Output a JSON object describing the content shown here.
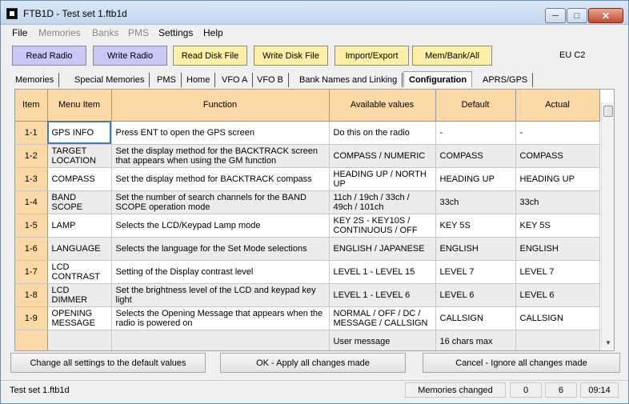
{
  "window": {
    "title": "FTB1D - Test set 1.ftb1d"
  },
  "menu": [
    {
      "label": "File",
      "disabled": false
    },
    {
      "label": "Memories",
      "disabled": true
    },
    {
      "label": "Banks",
      "disabled": true
    },
    {
      "label": "PMS",
      "disabled": true
    },
    {
      "label": "Settings",
      "disabled": false
    },
    {
      "label": "Help",
      "disabled": false
    }
  ],
  "toolbar": {
    "read_radio": "Read Radio",
    "write_radio": "Write Radio",
    "read_disk": "Read Disk File",
    "write_disk": "Write Disk File",
    "import_export": "Import/Export",
    "mem_bank_all": "Mem/Bank/All",
    "region": "EU C2"
  },
  "tabs": [
    "Memories",
    "Special Memories",
    "PMS",
    "Home",
    "VFO A",
    "VFO B",
    "Bank Names and Linking",
    "Configuration",
    "APRS/GPS"
  ],
  "table": {
    "headers": [
      "Item",
      "Menu Item",
      "Function",
      "Available values",
      "Default",
      "Actual"
    ],
    "rows": [
      [
        "1-1",
        "GPS INFO",
        "Press ENT to open the GPS screen",
        "Do this on the radio",
        "-",
        "-"
      ],
      [
        "1-2",
        "TARGET LOCATION",
        "Set the display method for the BACKTRACK screen that appears when using the GM function",
        "COMPASS / NUMERIC",
        "COMPASS",
        "COMPASS"
      ],
      [
        "1-3",
        "COMPASS",
        "Set the display method for BACKTRACK compass",
        "HEADING UP / NORTH UP",
        "HEADING UP",
        "HEADING UP"
      ],
      [
        "1-4",
        "BAND SCOPE",
        "Set the number of search channels for the BAND SCOPE operation mode",
        "11ch / 19ch / 33ch / 49ch / 101ch",
        "33ch",
        "33ch"
      ],
      [
        "1-5",
        "LAMP",
        "Selects the LCD/Keypad Lamp mode",
        "KEY 2S - KEY10S / CONTINUOUS / OFF",
        "KEY 5S",
        "KEY 5S"
      ],
      [
        "1-6",
        "LANGUAGE",
        "Selects the language for the Set Mode selections",
        "ENGLISH / JAPANESE",
        "ENGLISH",
        "ENGLISH"
      ],
      [
        "1-7",
        "LCD CONTRAST",
        "Setting of the Display contrast level",
        "LEVEL 1 - LEVEL 15",
        "LEVEL 7",
        "LEVEL 7"
      ],
      [
        "1-8",
        "LCD DIMMER",
        "Set the brightness level of the LCD and keypad key light",
        "LEVEL 1 - LEVEL 6",
        "LEVEL 6",
        "LEVEL 6"
      ],
      [
        "1-9",
        "OPENING MESSAGE",
        "Selects the Opening Message that appears when the radio is powered on",
        "NORMAL / OFF / DC / MESSAGE / CALLSIGN",
        "CALLSIGN",
        "CALLSIGN"
      ],
      [
        "",
        "",
        "",
        "User message",
        "16 chars max",
        ""
      ]
    ]
  },
  "buttons": {
    "defaults": "Change all settings to the default values",
    "ok": "OK - Apply all changes made",
    "cancel": "Cancel - Ignore all changes made"
  },
  "status": {
    "file": "Test set 1.ftb1d",
    "changed": "Memories changed",
    "count_a": "0",
    "count_b": "6",
    "time": "09:14"
  },
  "colors": {
    "header_orange": "#fbd9a7",
    "button_purple": "#c9c7f5",
    "button_yellow": "#fdf0a6"
  }
}
